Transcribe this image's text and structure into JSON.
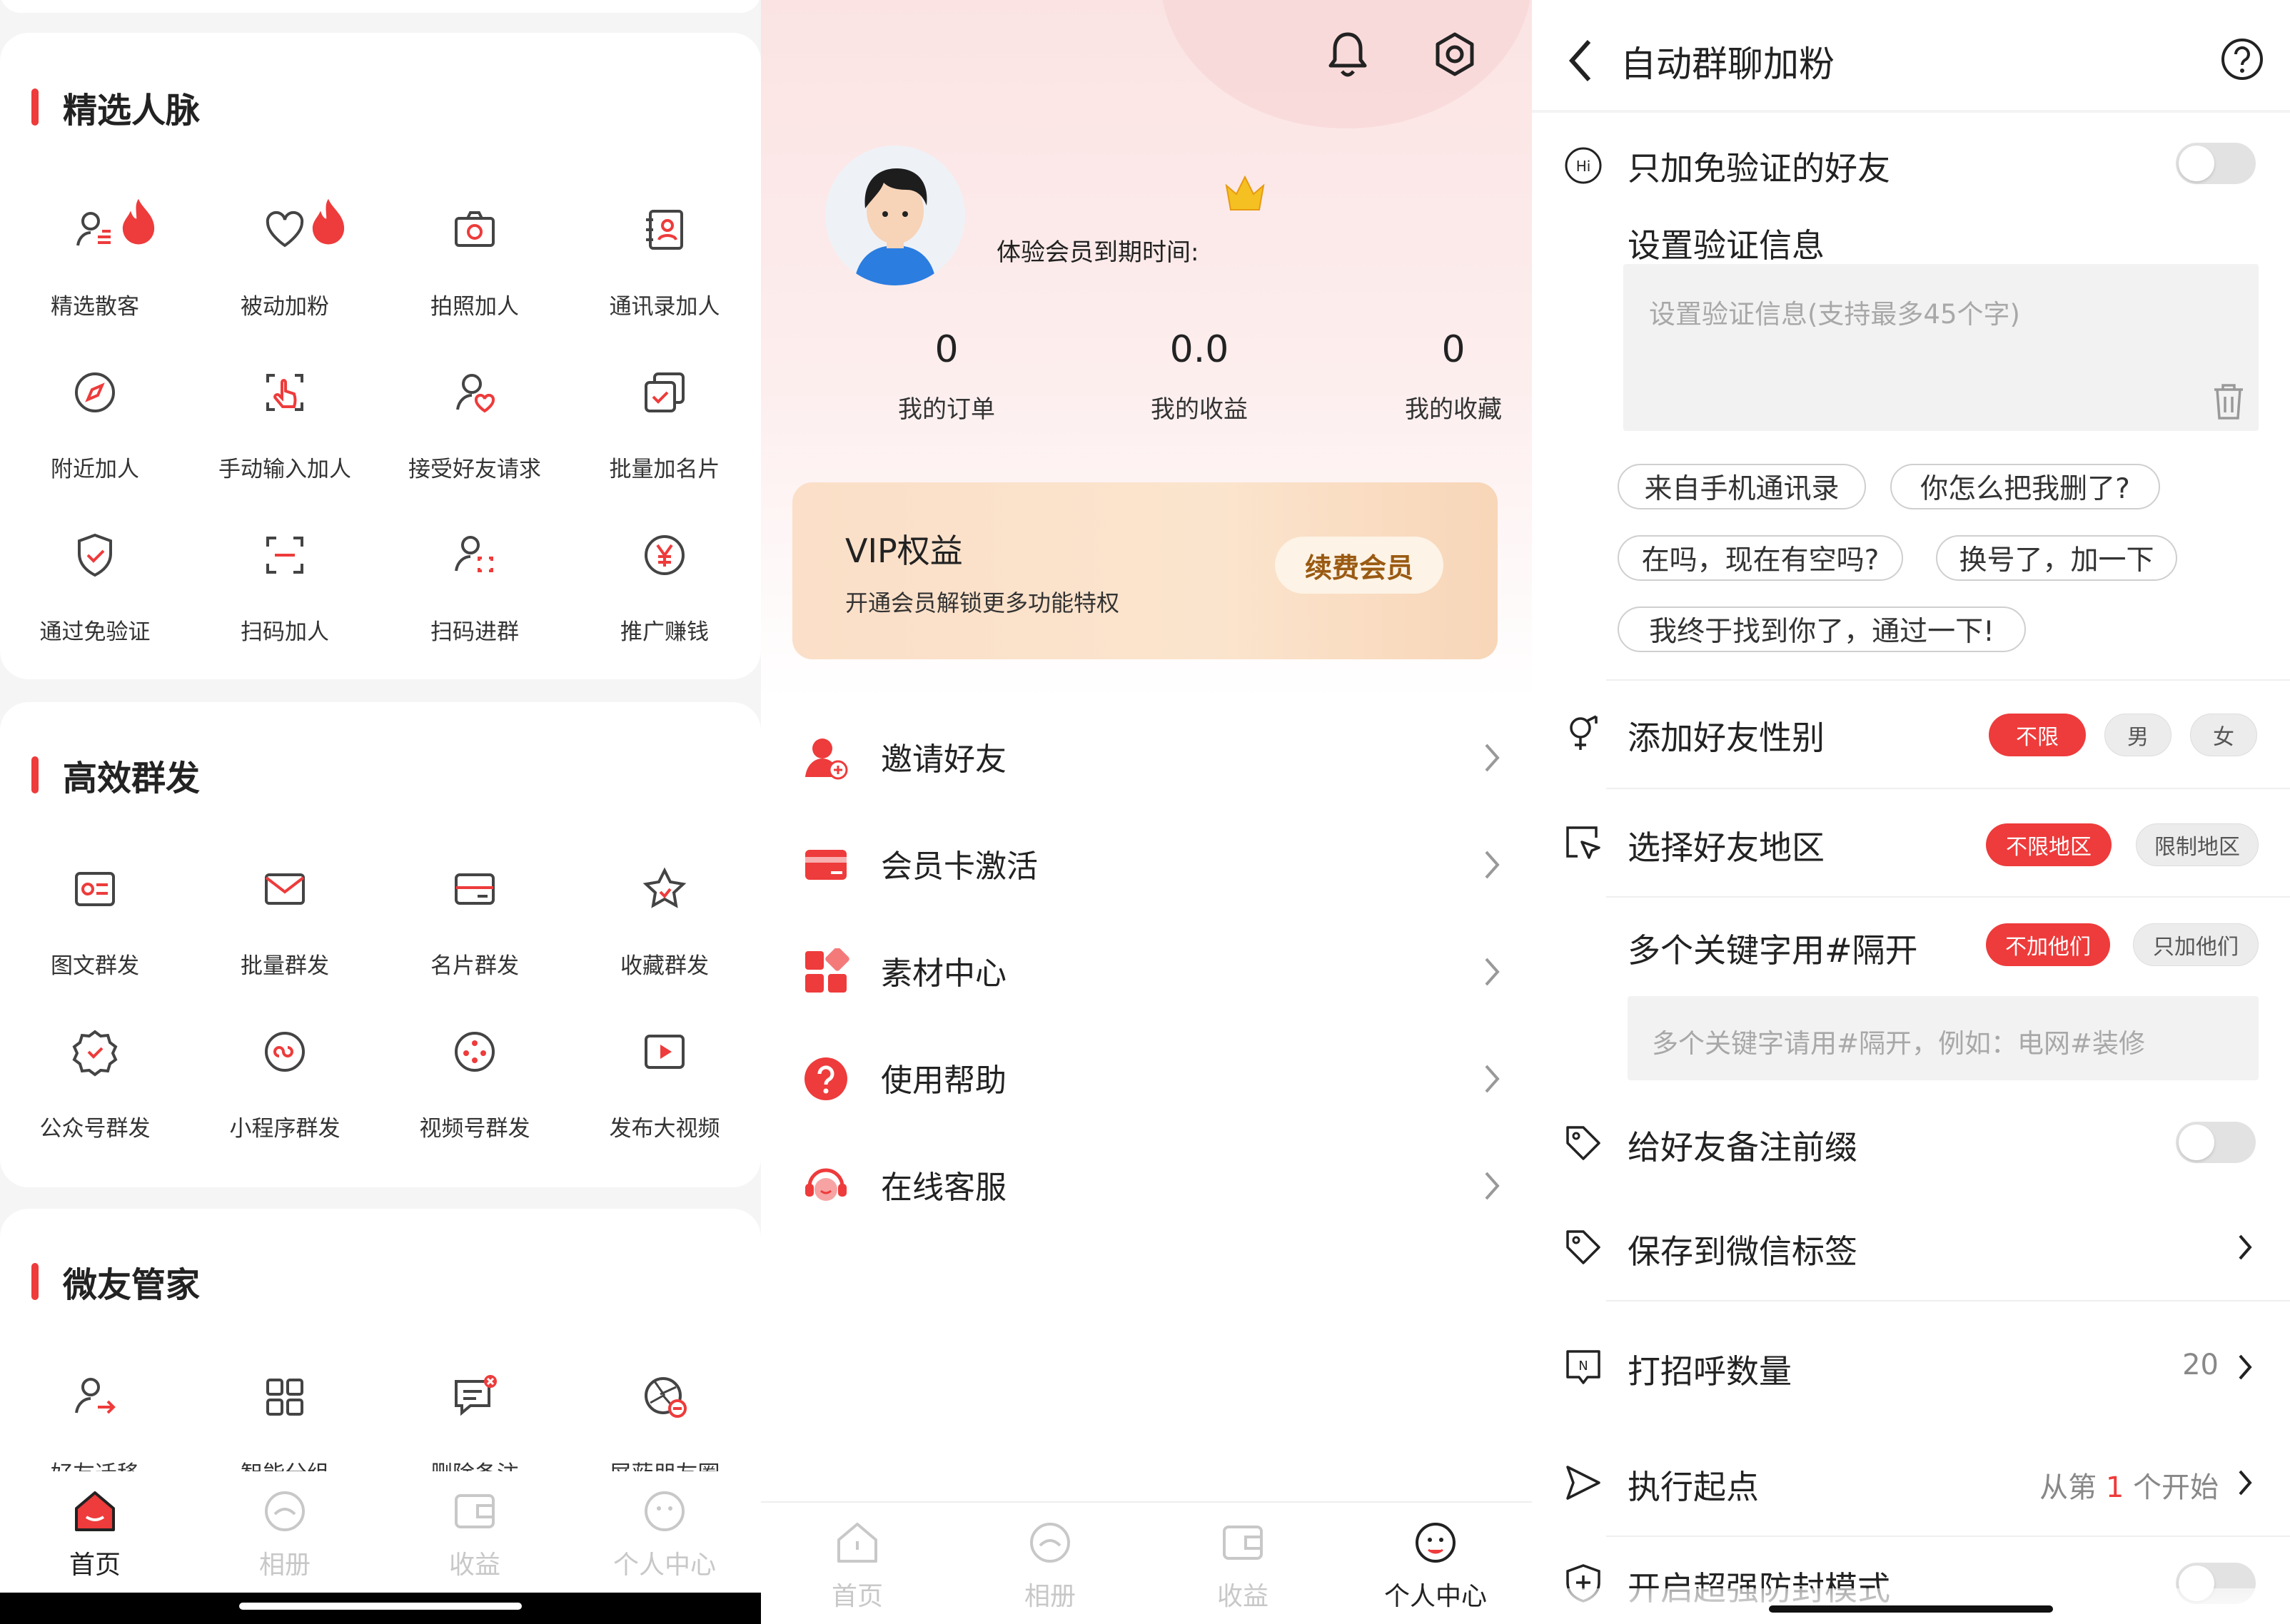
{
  "panel_home": {
    "sections": [
      {
        "title": "精选人脉",
        "items": [
          {
            "label": "精选散客",
            "icon": "person-list-icon",
            "hot": true
          },
          {
            "label": "被动加粉",
            "icon": "heart-icon",
            "hot": true
          },
          {
            "label": "拍照加人",
            "icon": "camera-icon",
            "hot": false
          },
          {
            "label": "通讯录加人",
            "icon": "contacts-icon",
            "hot": false
          },
          {
            "label": "附近加人",
            "icon": "compass-icon",
            "hot": false
          },
          {
            "label": "手动输入加人",
            "icon": "tap-icon",
            "hot": false
          },
          {
            "label": "接受好友请求",
            "icon": "person-heart-icon",
            "hot": false
          },
          {
            "label": "批量加名片",
            "icon": "cards-icon",
            "hot": false
          },
          {
            "label": "通过免验证",
            "icon": "shield-check-icon",
            "hot": false
          },
          {
            "label": "扫码加人",
            "icon": "scan-icon",
            "hot": false
          },
          {
            "label": "扫码进群",
            "icon": "person-scan-icon",
            "hot": false
          },
          {
            "label": "推广赚钱",
            "icon": "yen-icon",
            "hot": false
          }
        ]
      },
      {
        "title": "高效群发",
        "items": [
          {
            "label": "图文群发",
            "icon": "image-text-icon"
          },
          {
            "label": "批量群发",
            "icon": "mail-icon"
          },
          {
            "label": "名片群发",
            "icon": "card-icon"
          },
          {
            "label": "收藏群发",
            "icon": "star-icon"
          },
          {
            "label": "公众号群发",
            "icon": "badge-check-icon"
          },
          {
            "label": "小程序群发",
            "icon": "mini-program-icon"
          },
          {
            "label": "视频号群发",
            "icon": "film-reel-icon"
          },
          {
            "label": "发布大视频",
            "icon": "play-icon"
          }
        ]
      },
      {
        "title": "微友管家",
        "items": [
          {
            "label": "好友迁移",
            "icon": "person-arrow-icon"
          },
          {
            "label": "智能分组",
            "icon": "grid-icon"
          },
          {
            "label": "删除备注",
            "icon": "note-delete-icon"
          },
          {
            "label": "屏蔽朋友圈",
            "icon": "aperture-block-icon"
          }
        ]
      }
    ],
    "tabs": [
      {
        "label": "首页",
        "active": true
      },
      {
        "label": "相册",
        "active": false
      },
      {
        "label": "收益",
        "active": false
      },
      {
        "label": "个人中心",
        "active": false
      }
    ]
  },
  "panel_profile": {
    "member_expiry_label": "体验会员到期时间:",
    "stats": [
      {
        "value": "0",
        "label": "我的订单"
      },
      {
        "value": "0.0",
        "label": "我的收益"
      },
      {
        "value": "0",
        "label": "我的收藏"
      }
    ],
    "vip": {
      "title": "VIP权益",
      "subtitle": "开通会员解锁更多功能特权",
      "button": "续费会员"
    },
    "menu": [
      {
        "label": "邀请好友",
        "icon": "invite-friend-icon"
      },
      {
        "label": "会员卡激活",
        "icon": "member-card-icon"
      },
      {
        "label": "素材中心",
        "icon": "material-center-icon"
      },
      {
        "label": "使用帮助",
        "icon": "help-icon"
      },
      {
        "label": "在线客服",
        "icon": "customer-service-icon"
      }
    ],
    "tabs": [
      {
        "label": "首页",
        "active": false
      },
      {
        "label": "相册",
        "active": false
      },
      {
        "label": "收益",
        "active": false
      },
      {
        "label": "个人中心",
        "active": true
      }
    ]
  },
  "panel_settings": {
    "title": "自动群聊加粉",
    "only_no_verify": {
      "label": "只加免验证的好友",
      "on": false
    },
    "verify_msg": {
      "label": "设置验证信息",
      "placeholder": "设置验证信息(支持最多45个字)"
    },
    "templates": [
      "来自手机通讯录",
      "你怎么把我删了?",
      "在吗，现在有空吗?",
      "换号了，加一下",
      "我终于找到你了，通过一下!"
    ],
    "gender": {
      "label": "添加好友性别",
      "options": [
        "不限",
        "男",
        "女"
      ],
      "selected": "不限"
    },
    "region": {
      "label": "选择好友地区",
      "options": [
        "不限地区",
        "限制地区"
      ],
      "selected": "不限地区"
    },
    "keywords": {
      "label": "多个关键字用#隔开",
      "options": [
        "不加他们",
        "只加他们"
      ],
      "selected": "不加他们",
      "placeholder": "多个关键字请用#隔开，例如：电网#装修"
    },
    "remark_prefix": {
      "label": "给好友备注前缀",
      "on": false
    },
    "save_tag": {
      "label": "保存到微信标签"
    },
    "greet_count": {
      "label": "打招呼数量",
      "value": "20"
    },
    "start_point": {
      "label": "执行起点",
      "prefix": "从第",
      "value": "1",
      "suffix": "个开始"
    },
    "anti_block": {
      "label": "开启超强防封模式",
      "on": false
    }
  },
  "colors": {
    "accent": "#ee3b3b",
    "vip_gold": "#9a5a12",
    "icon_gray": "#444444",
    "tab_inactive": "#c8c8c8"
  }
}
